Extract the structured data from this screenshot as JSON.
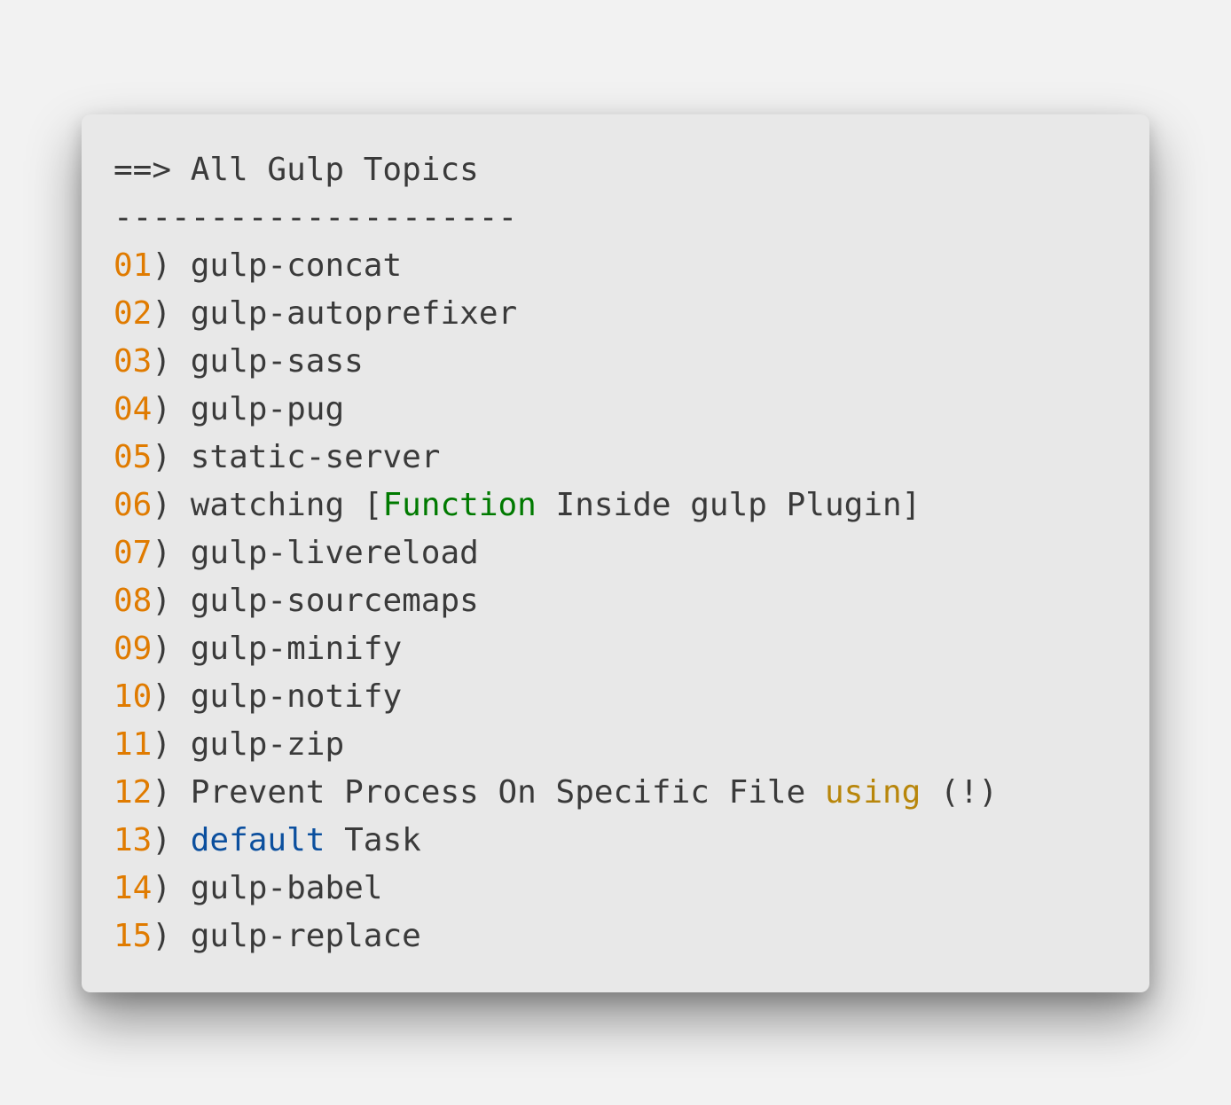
{
  "title": "==> All Gulp Topics",
  "separator": "---------------------",
  "colors": {
    "text": "#3a3a3a",
    "number": "#e07b00",
    "function_keyword": "#007a00",
    "using_keyword": "#b8860b",
    "default_keyword": "#0b4f9e",
    "card_background": "#e8e8e8",
    "page_background": "#f2f2f2"
  },
  "items": [
    {
      "num": "01",
      "segments": [
        {
          "text": " gulp-concat"
        }
      ]
    },
    {
      "num": "02",
      "segments": [
        {
          "text": " gulp-autoprefixer"
        }
      ]
    },
    {
      "num": "03",
      "segments": [
        {
          "text": " gulp-sass"
        }
      ]
    },
    {
      "num": "04",
      "segments": [
        {
          "text": " gulp-pug"
        }
      ]
    },
    {
      "num": "05",
      "segments": [
        {
          "text": " static-server"
        }
      ]
    },
    {
      "num": "06",
      "segments": [
        {
          "text": " watching ["
        },
        {
          "text": "Function",
          "style": "function_keyword"
        },
        {
          "text": " Inside gulp Plugin]"
        }
      ]
    },
    {
      "num": "07",
      "segments": [
        {
          "text": " gulp-livereload"
        }
      ]
    },
    {
      "num": "08",
      "segments": [
        {
          "text": " gulp-sourcemaps"
        }
      ]
    },
    {
      "num": "09",
      "segments": [
        {
          "text": " gulp-minify"
        }
      ]
    },
    {
      "num": "10",
      "segments": [
        {
          "text": " gulp-notify"
        }
      ]
    },
    {
      "num": "11",
      "segments": [
        {
          "text": " gulp-zip"
        }
      ]
    },
    {
      "num": "12",
      "segments": [
        {
          "text": " Prevent Process On Specific File "
        },
        {
          "text": "using",
          "style": "using_keyword"
        },
        {
          "text": " (!)"
        }
      ]
    },
    {
      "num": "13",
      "segments": [
        {
          "text": " "
        },
        {
          "text": "default",
          "style": "default_keyword"
        },
        {
          "text": " Task"
        }
      ]
    },
    {
      "num": "14",
      "segments": [
        {
          "text": " gulp-babel"
        }
      ]
    },
    {
      "num": "15",
      "segments": [
        {
          "text": " gulp-replace"
        }
      ]
    }
  ]
}
